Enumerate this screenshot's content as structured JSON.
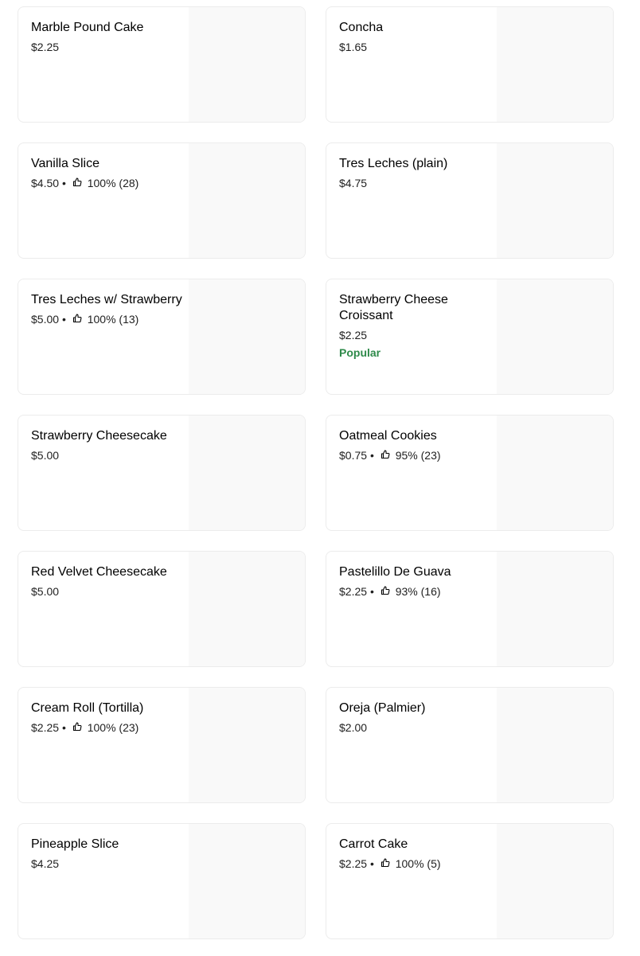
{
  "menu_items": [
    {
      "name": "Marble Pound Cake",
      "price": "$2.25",
      "rating": "",
      "popular": ""
    },
    {
      "name": "Concha",
      "price": "$1.65",
      "rating": "",
      "popular": ""
    },
    {
      "name": "Vanilla Slice",
      "price": "$4.50",
      "rating": "100% (28)",
      "popular": ""
    },
    {
      "name": "Tres Leches (plain)",
      "price": "$4.75",
      "rating": "",
      "popular": ""
    },
    {
      "name": "Tres Leches w/ Strawberry",
      "price": "$5.00",
      "rating": "100% (13)",
      "popular": ""
    },
    {
      "name": "Strawberry Cheese Croissant",
      "price": "$2.25",
      "rating": "",
      "popular": "Popular"
    },
    {
      "name": "Strawberry Cheesecake",
      "price": "$5.00",
      "rating": "",
      "popular": ""
    },
    {
      "name": "Oatmeal Cookies",
      "price": "$0.75",
      "rating": "95% (23)",
      "popular": ""
    },
    {
      "name": "Red Velvet Cheesecake",
      "price": "$5.00",
      "rating": "",
      "popular": ""
    },
    {
      "name": "Pastelillo De Guava",
      "price": "$2.25",
      "rating": "93% (16)",
      "popular": ""
    },
    {
      "name": "Cream Roll (Tortilla)",
      "price": "$2.25",
      "rating": "100% (23)",
      "popular": ""
    },
    {
      "name": "Oreja (Palmier)",
      "price": "$2.00",
      "rating": "",
      "popular": ""
    },
    {
      "name": "Pineapple Slice",
      "price": "$4.25",
      "rating": "",
      "popular": ""
    },
    {
      "name": "Carrot Cake",
      "price": "$2.25",
      "rating": "100% (5)",
      "popular": ""
    }
  ],
  "meta_separator": "•",
  "colors": {
    "popular": "#2e8a4a",
    "card_border": "#ececec",
    "image_placeholder": "#f9f9f9"
  },
  "icons": {
    "rating": "thumbs-up-icon"
  }
}
